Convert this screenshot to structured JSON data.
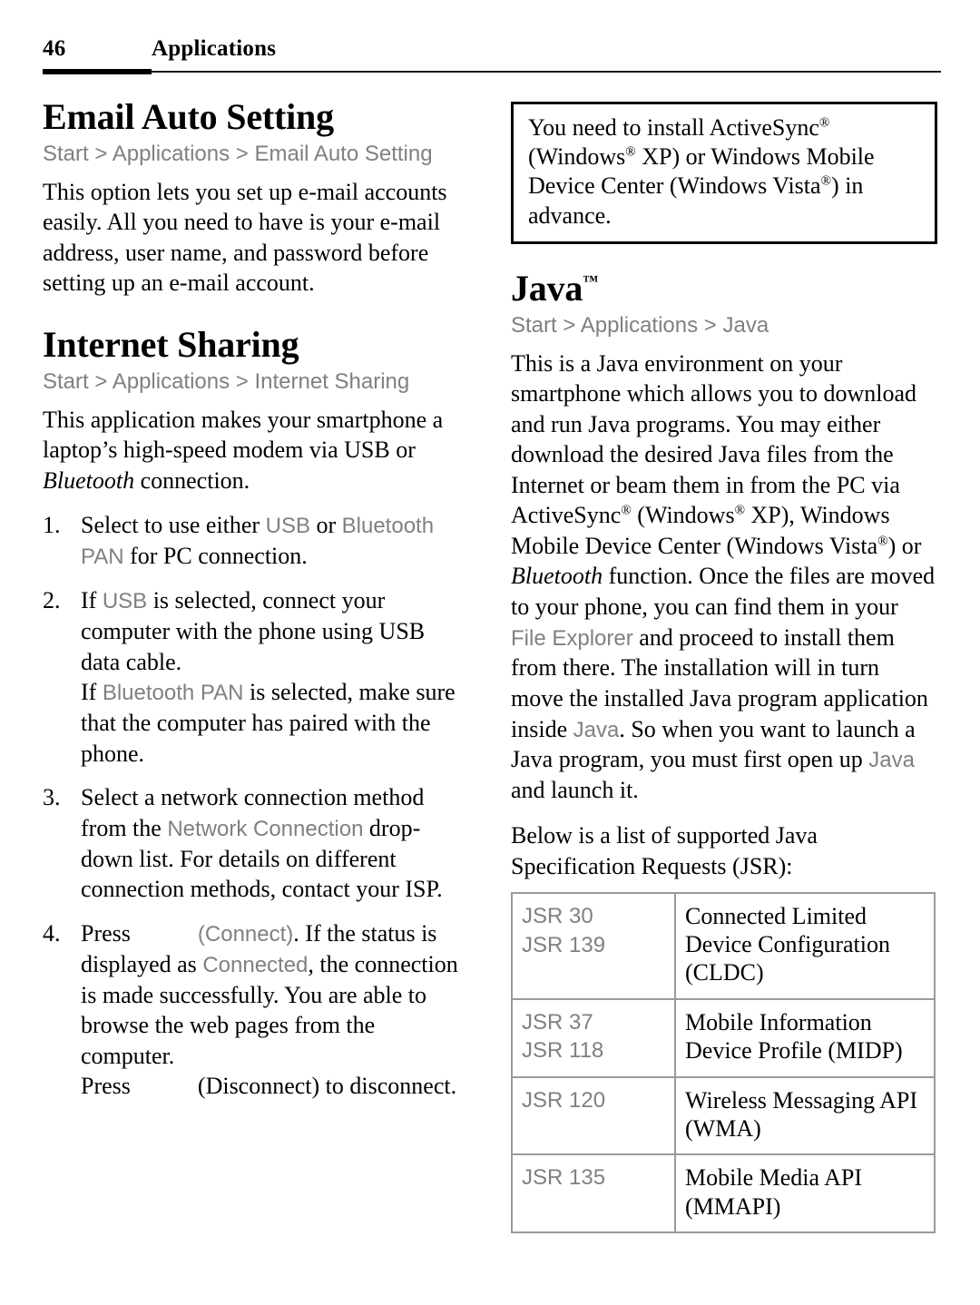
{
  "header": {
    "page_number": "46",
    "title": "Applications"
  },
  "left_column": {
    "email_auto_setting": {
      "heading": "Email Auto Setting",
      "breadcrumb": "Start > Applications > Email Auto Setting",
      "paragraph": "This option lets you set up e-mail accounts easily. All you need to have is your e-mail address, user name, and password before setting up an e-mail account."
    },
    "internet_sharing": {
      "heading": "Internet Sharing",
      "breadcrumb": "Start > Applications > Internet Sharing",
      "paragraph_part1": "This application makes your smartphone a laptop’s high-speed modem via USB or ",
      "paragraph_bluetooth": "Bluetooth",
      "paragraph_part2": " connection.",
      "steps": [
        {
          "t1": "Select to use either ",
          "ui1": "USB",
          "t2": " or ",
          "ui2": "Bluetooth PAN",
          "t3": " for PC connection."
        },
        {
          "t1": "If ",
          "ui1": "USB",
          "t2": " is selected, connect your computer with the phone using USB data cable.",
          "sub_t1": "If ",
          "sub_ui1": "Bluetooth PAN",
          "sub_t2": " is selected, make sure that the computer has paired with the phone."
        },
        {
          "t1": "Select a network connection method from the ",
          "ui1": "Network Connection",
          "t2": " drop-down list. For details on different connection methods, contact your ISP."
        },
        {
          "t1": "Press",
          "ui1": "(Connect)",
          "t2": ". If the status is displayed as ",
          "ui2": "Connected",
          "t3": ", the connection is made successfully. You are able to browse the web pages from the computer.",
          "sub_t1": "Press",
          "sub_t2": "(Disconnect) to disconnect."
        }
      ]
    }
  },
  "right_column": {
    "note": {
      "t1": "You need to install ActiveSync",
      "reg1": "®",
      "t2": " (Windows",
      "reg2": "®",
      "t3": " XP) or Windows Mobile Device Center (Windows Vista",
      "reg3": "®",
      "t4": ") in advance."
    },
    "java": {
      "heading": "Java",
      "heading_tm": "™",
      "breadcrumb": "Start > Applications > Java",
      "para1_t1": "This is a Java environment on your smartphone which allows you to download and run Java programs. You may either download the desired Java files from the Internet or beam them in from the PC via ActiveSync",
      "para1_reg1": "®",
      "para1_t2": " (Windows",
      "para1_reg2": "®",
      "para1_t3": " XP), Windows Mobile Device Center (Windows Vista",
      "para1_reg3": "®",
      "para1_t4": ") or ",
      "para1_bluetooth": "Bluetooth",
      "para1_t5": " function. Once the files are moved to your phone, you can find them in your ",
      "para1_ui1": "File Explorer",
      "para1_t6": " and proceed to install them from there. The installation will in turn move the installed Java program application inside ",
      "para1_ui2": "Java",
      "para1_t7": ". So when you want to launch a Java program, you must first open up ",
      "para1_ui3": "Java",
      "para1_t8": " and launch it.",
      "para2": "Below is a list of supported Java Specification Requests (JSR):",
      "jsr_table": [
        {
          "code": "JSR 30\nJSR 139",
          "description": "Connected Limited Device Configuration (CLDC)"
        },
        {
          "code": "JSR 37\nJSR 118",
          "description": "Mobile Information Device Profile (MIDP)"
        },
        {
          "code": "JSR 120",
          "description": "Wireless Messaging API (WMA)"
        },
        {
          "code": "JSR 135",
          "description": "Mobile Media API (MMAPI)"
        }
      ]
    }
  },
  "colors": {
    "ui_reference_gray": "#808080",
    "table_border_gray": "#9a9a9a",
    "note_border": "#000000",
    "text": "#000000"
  }
}
